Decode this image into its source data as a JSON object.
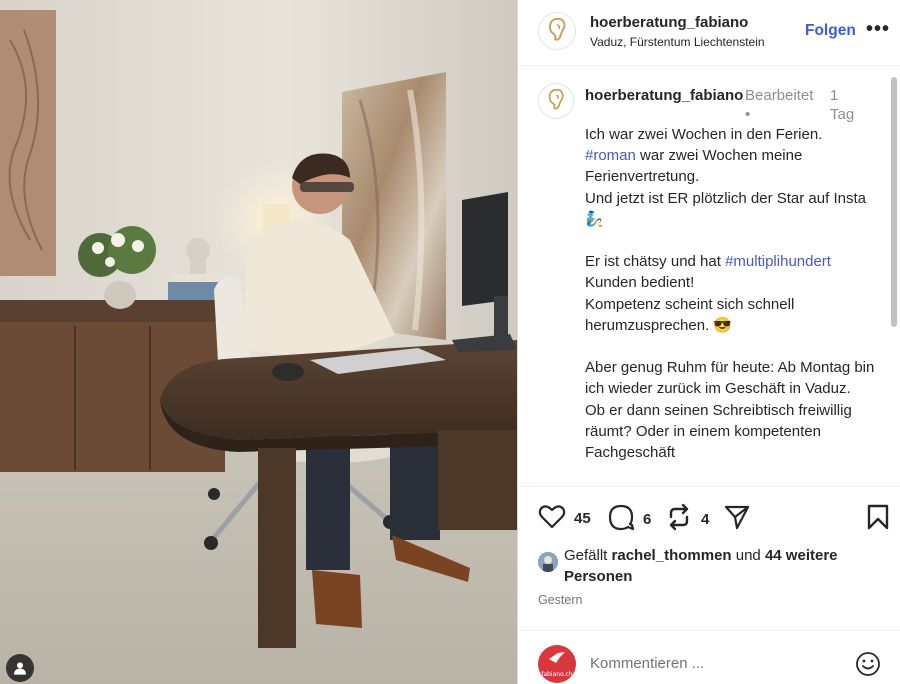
{
  "post": {
    "username": "hoerberatung_fabiano",
    "location": "Vaduz, Fürstentum Liechtenstein",
    "follow_label": "Folgen",
    "more_label": "•••"
  },
  "caption": {
    "username": "hoerberatung_fabiano",
    "edited_label": "Bearbeitet",
    "separator": "•",
    "age": "1 Tag",
    "line1": "Ich war zwei Wochen in den Ferien.",
    "hashtag_roman": "#roman",
    "line2_rest": " war zwei Wochen meine Ferienvertretung.",
    "line3": "Und jetzt ist ER plötzlich der Star auf Insta 🧞",
    "line4_start": "Er ist chätsy und hat ",
    "hashtag_multi": "#multiplihundert",
    "line4_rest": " Kunden bedient!",
    "line5": "Kompetenz scheint sich schnell herumzusprechen. 😎",
    "line6": "Aber genug Ruhm für heute: Ab Montag bin ich wieder zurück im Geschäft in Vaduz.",
    "line7": "Ob er dann seinen Schreibtisch freiwillig räumt? Oder in einem kompetenten Fachgeschäft"
  },
  "actions": {
    "like_count": "45",
    "comment_count": "6",
    "repost_count": "4"
  },
  "likes": {
    "prefix": "Gefällt ",
    "user": "rachel_thommen",
    "middle": " und ",
    "others": "44 weitere Personen"
  },
  "timestamp": "Gestern",
  "comment": {
    "avatar_label": "fabiano.ch",
    "placeholder": "Kommentieren ..."
  },
  "icons": {
    "like": "heart-icon",
    "comment": "comment-bubble-icon",
    "repost": "repost-icon",
    "share": "send-paper-plane-icon",
    "save": "bookmark-icon",
    "emoji": "emoji-smiley-icon",
    "user_tag": "person-tag-icon"
  },
  "colors": {
    "accent": "#3b5bdb",
    "hashtag": "#4a57c8",
    "muted": "#8e8e8e",
    "text": "#262626"
  }
}
